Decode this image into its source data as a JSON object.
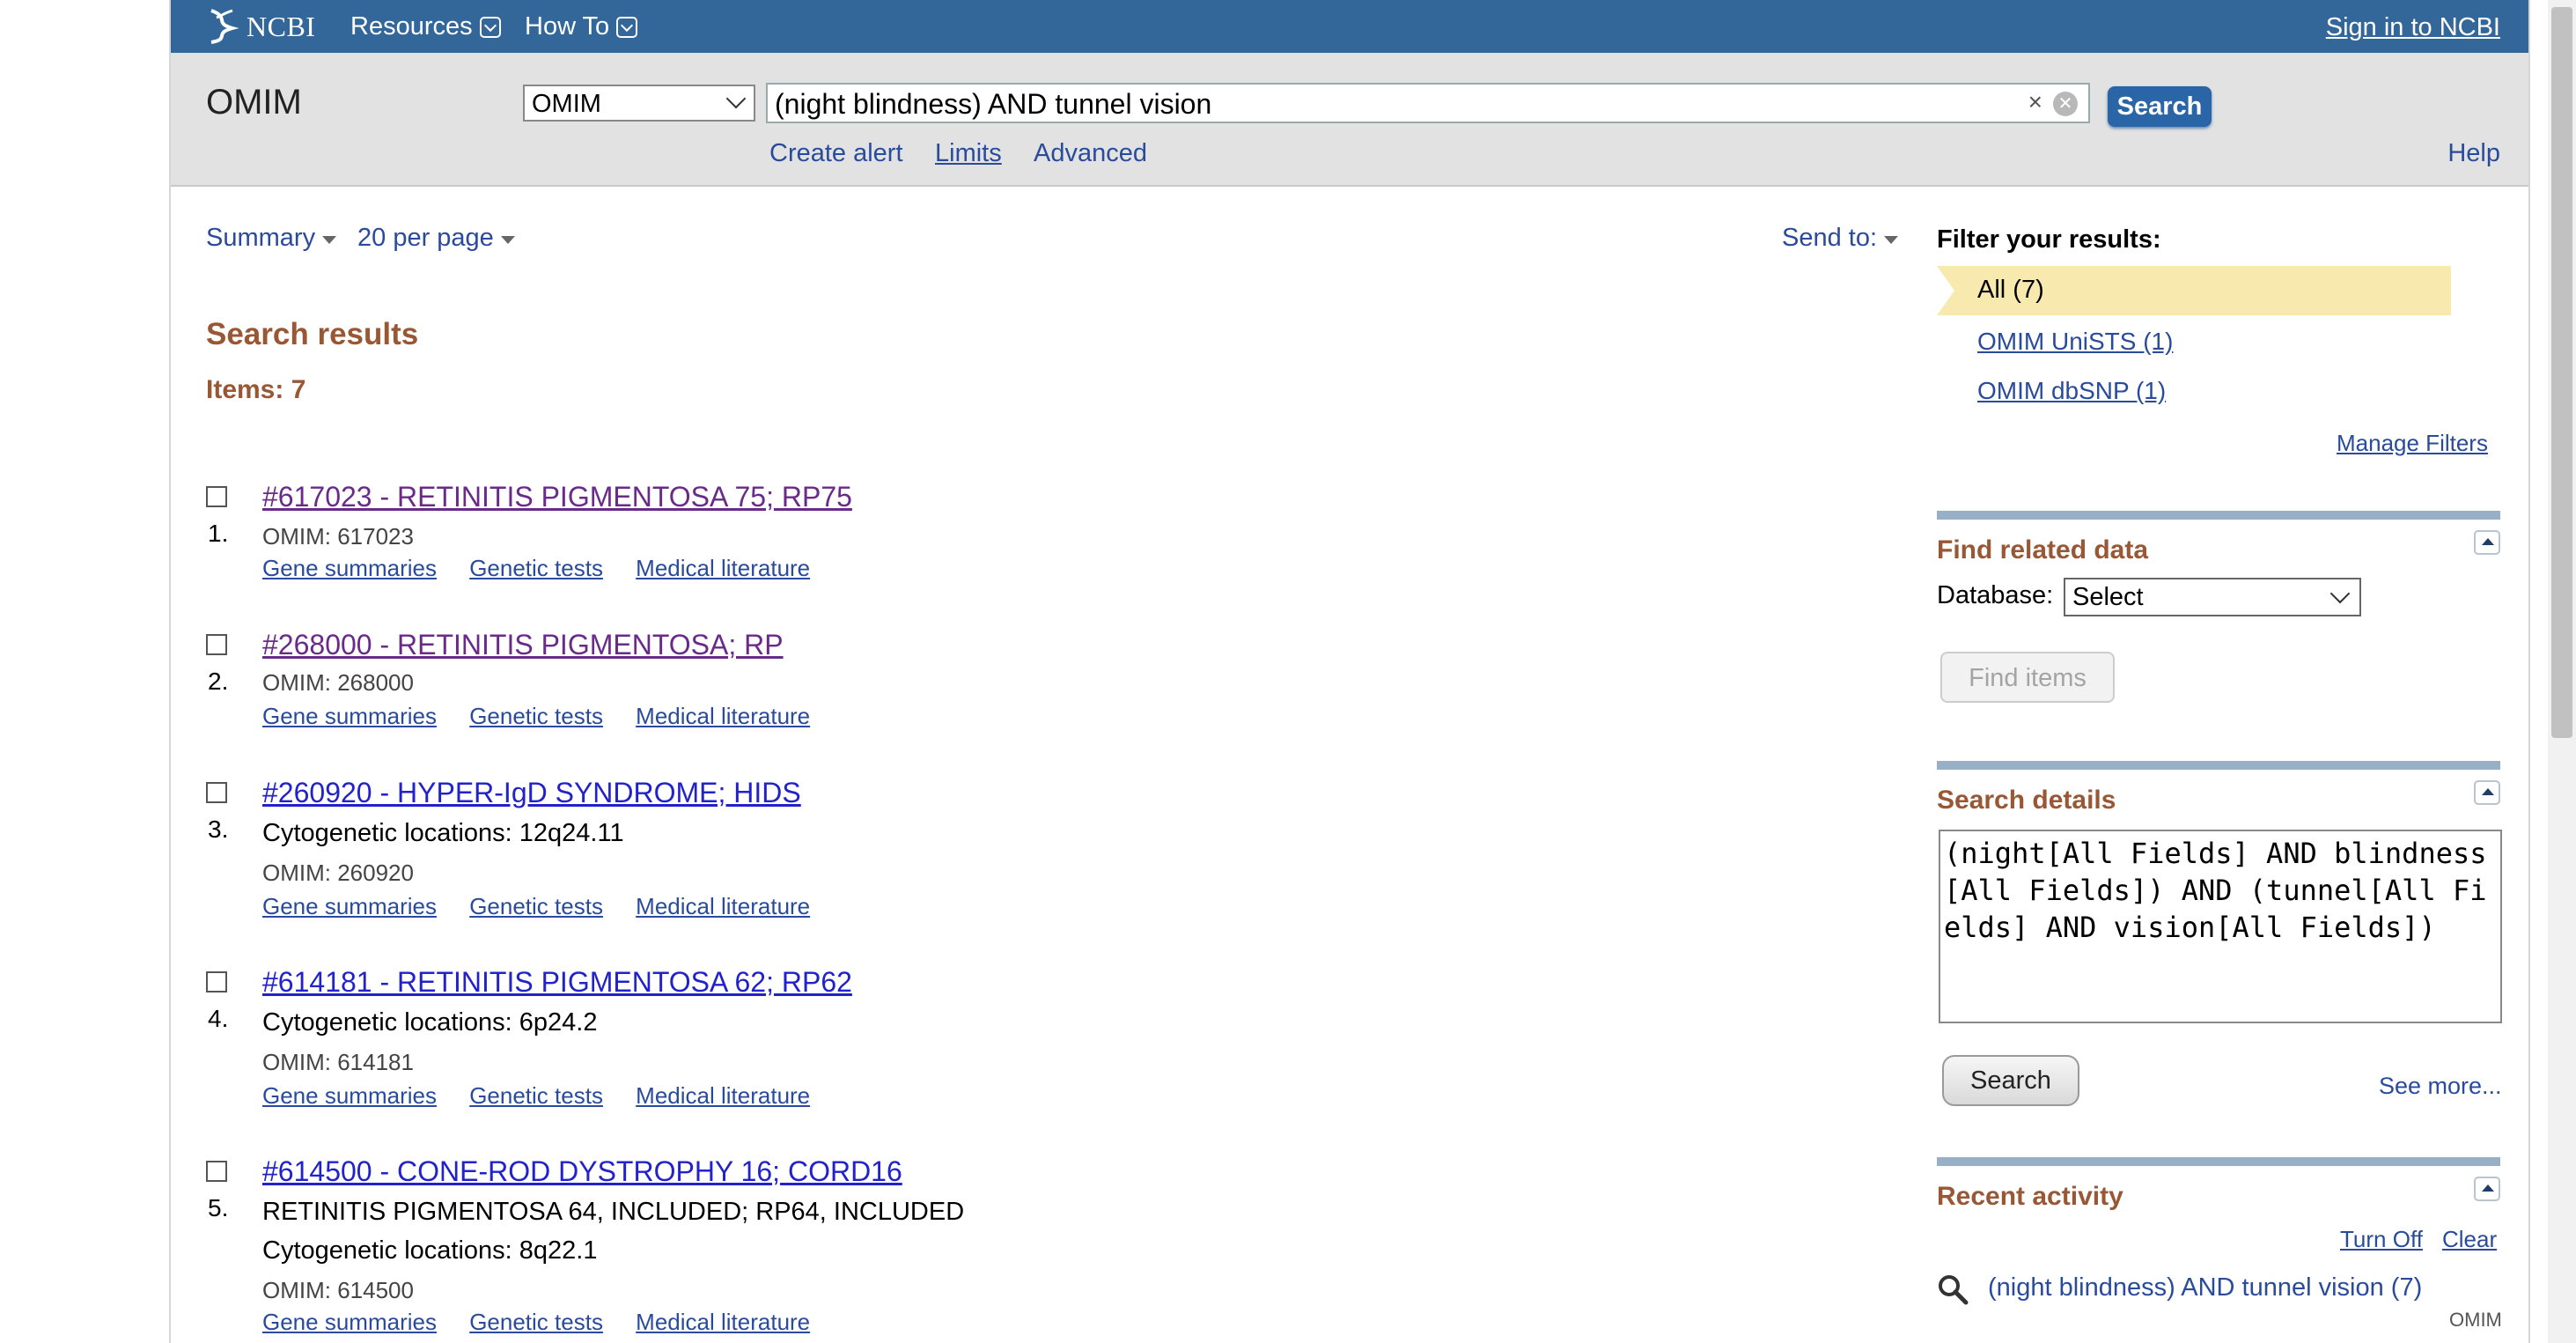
{
  "topbar": {
    "logo_text": "NCBI",
    "menus": [
      "Resources",
      "How To"
    ],
    "signin": "Sign in to NCBI"
  },
  "search": {
    "db_name": "OMIM",
    "db_select": "OMIM",
    "term": "(night blindness) AND tunnel vision",
    "clear_x": "×",
    "clear_circle": "✕",
    "button": "Search",
    "links": [
      "Create alert",
      "Limits",
      "Advanced"
    ],
    "help": "Help"
  },
  "display": {
    "summary": "Summary",
    "per_page": "20 per page",
    "send_to": "Send to:"
  },
  "results": {
    "title": "Search results",
    "count": "Items: 7",
    "items": [
      {
        "num": "1.",
        "title": "#617023 - RETINITIS PIGMENTOSA 75; RP75",
        "extra": [],
        "omim": "OMIM: 617023"
      },
      {
        "num": "2.",
        "title": "#268000 - RETINITIS PIGMENTOSA; RP",
        "extra": [],
        "omim": "OMIM: 268000"
      },
      {
        "num": "3.",
        "title": "#260920 - HYPER-IgD SYNDROME; HIDS",
        "extra": [
          "Cytogenetic locations: 12q24.11"
        ],
        "omim": "OMIM: 260920"
      },
      {
        "num": "4.",
        "title": "#614181 - RETINITIS PIGMENTOSA 62; RP62",
        "extra": [
          "Cytogenetic locations: 6p24.2"
        ],
        "omim": "OMIM: 614181"
      },
      {
        "num": "5.",
        "title": "#614500 - CONE-ROD DYSTROPHY 16; CORD16",
        "extra": [
          "RETINITIS PIGMENTOSA 64, INCLUDED; RP64, INCLUDED",
          "Cytogenetic locations: 8q22.1"
        ],
        "omim": "OMIM: 614500"
      }
    ],
    "links": [
      "Gene summaries",
      "Genetic tests",
      "Medical literature"
    ]
  },
  "filters": {
    "heading": "Filter your results:",
    "all": "All (7)",
    "items": [
      "OMIM UniSTS (1)",
      "OMIM dbSNP (1)"
    ],
    "manage": "Manage Filters"
  },
  "related": {
    "title": "Find related data",
    "db_label": "Database:",
    "db_value": "Select",
    "button": "Find items"
  },
  "details": {
    "title": "Search details",
    "query": "(night[All Fields] AND blindness[All Fields]) AND (tunnel[All Fields] AND vision[All Fields])",
    "button": "Search",
    "see_more": "See more..."
  },
  "recent": {
    "title": "Recent activity",
    "turn_off": "Turn Off",
    "clear": "Clear",
    "item": "(night blindness) AND tunnel vision (7)",
    "item_db": "OMIM"
  }
}
